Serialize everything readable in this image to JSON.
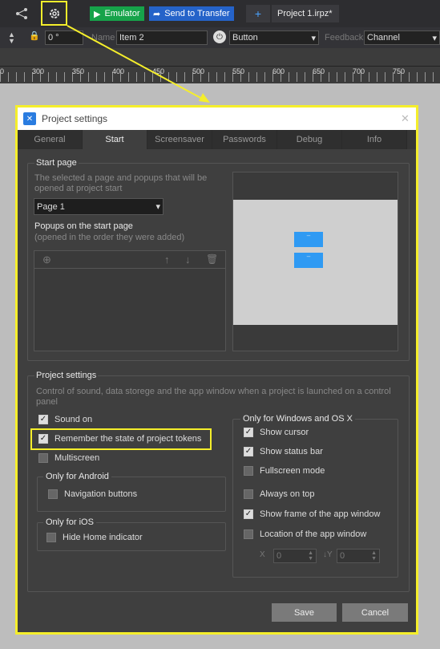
{
  "toolbar": {
    "emulator_label": "Emulator",
    "send_label": "Send to Transfer",
    "add_label": "+",
    "project_tab": "Project 1.irpz*"
  },
  "props": {
    "angle": "0 °",
    "name_label": "Name",
    "name_value": "Item 2",
    "type_value": "Button",
    "feedback_label": "Feedback",
    "feedback_value": "Channel"
  },
  "ruler": {
    "ticks": [
      "250",
      "300",
      "350",
      "400",
      "450",
      "500",
      "550",
      "600",
      "650",
      "700",
      "750"
    ]
  },
  "dialog": {
    "title": "Project settings",
    "tabs": [
      "General",
      "Start",
      "Screensaver",
      "Passwords",
      "Debug",
      "Info"
    ],
    "active_tab": "Start",
    "start_page": {
      "label": "Start page",
      "desc": "The selected a page and popups that will be opened at project start",
      "page_value": "Page 1",
      "popups_label": "Popups on the start page",
      "popups_desc": "(opened in the order they were added)",
      "preview_bg": "#cfcfcf",
      "preview_btn": "#2f9af3"
    },
    "project_settings": {
      "label": "Project settings",
      "desc": "Control of sound, data storege and the app window when a project is launched on a control panel",
      "sound_on": "Sound on",
      "remember": "Remember the state of project tokens",
      "multiscreen": "Multiscreen",
      "android_label": "Only for Android",
      "nav_buttons": "Navigation buttons",
      "ios_label": "Only for iOS",
      "hide_home": "Hide Home indicator",
      "win_label": "Only for Windows and OS X",
      "show_cursor": "Show cursor",
      "show_status": "Show status bar",
      "fullscreen": "Fullscreen mode",
      "always_top": "Always on top",
      "show_frame": "Show frame of the app window",
      "location": "Location of the app window",
      "x_label": "X",
      "x_value": "0",
      "y_label": "Y",
      "y_value": "0"
    },
    "save_label": "Save",
    "cancel_label": "Cancel"
  },
  "highlight_color": "#f5ee2b"
}
